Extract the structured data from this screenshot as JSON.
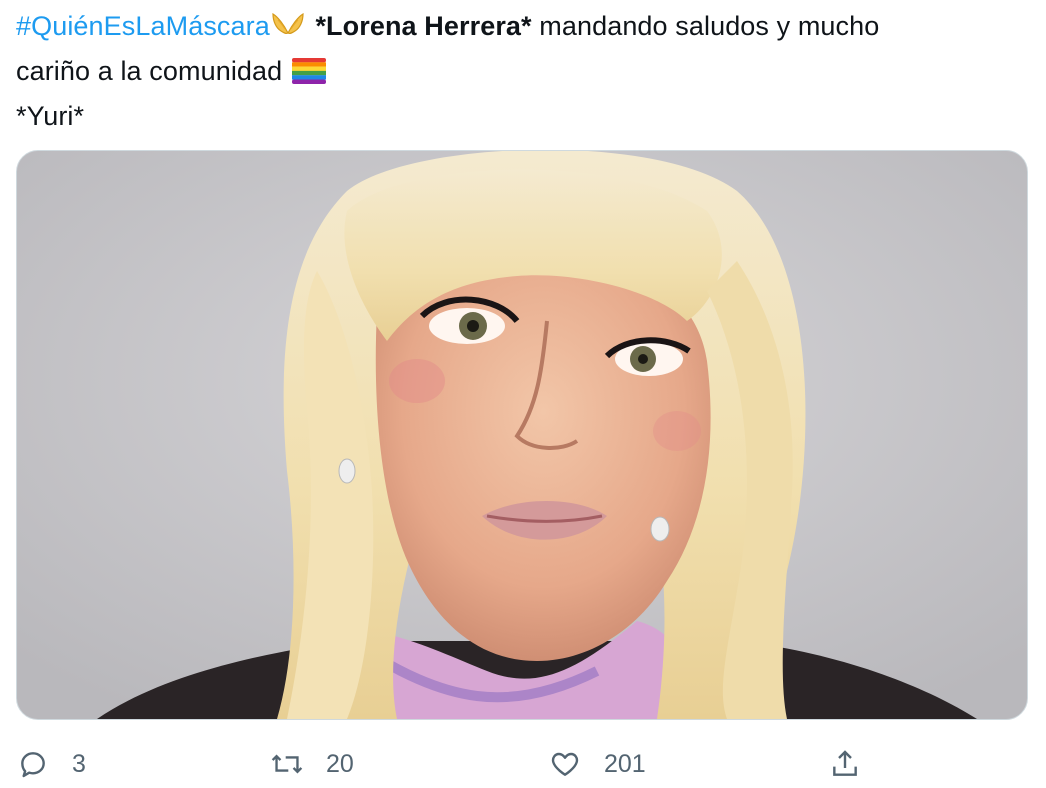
{
  "tweet": {
    "hashtag": "#QuiénEsLaMáscara",
    "bold_name": "*Lorena Herrera*",
    "text_after_name": " mandando saludos y mucho",
    "line2": "cariño a la comunidad",
    "line3": "*Yuri*",
    "emoji_after_hashtag": "butterfly-mask-emoji",
    "emoji_after_line2": "rainbow-flag-emoji"
  },
  "media": {
    "alt": "photo of a blonde woman"
  },
  "actions": {
    "reply_count": "3",
    "retweet_count": "20",
    "like_count": "201",
    "icons": [
      "reply-icon",
      "retweet-icon",
      "like-icon",
      "share-icon"
    ]
  },
  "colors": {
    "link": "#1d9bf0",
    "text": "#0f1419",
    "muted": "#536471",
    "border": "#cfd9de"
  }
}
